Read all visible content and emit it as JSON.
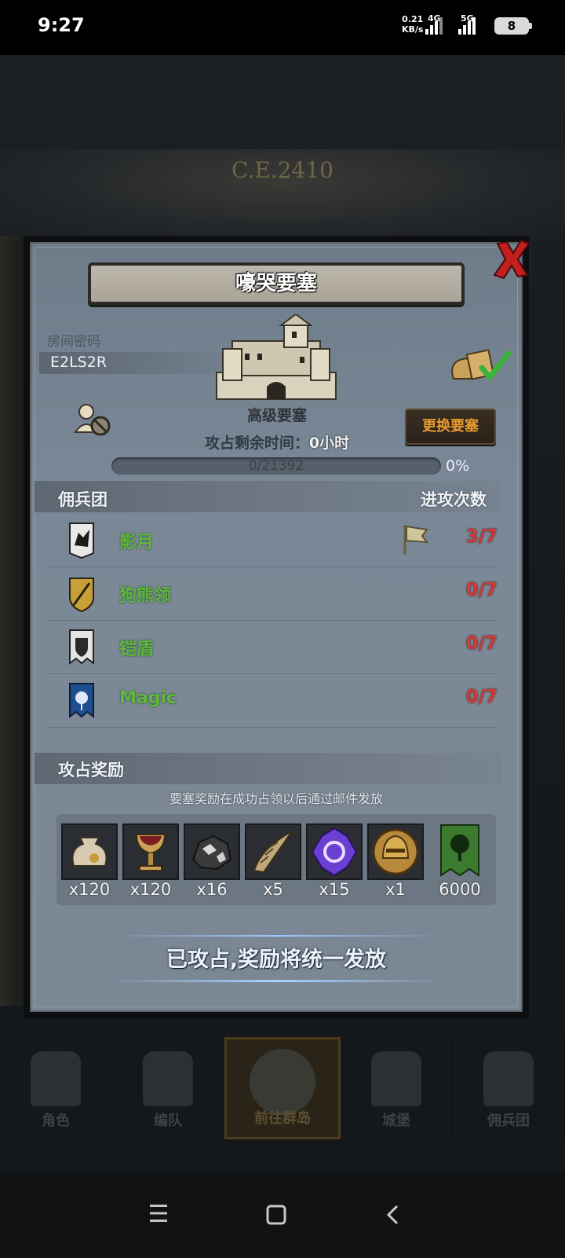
{
  "status_bar": {
    "time": "9:27",
    "net_speed": "0.21",
    "net_unit": "KB/s",
    "net1": "4G",
    "net2": "5G",
    "battery": "8"
  },
  "background": {
    "era": "C.E.2410"
  },
  "dialog": {
    "title": "嚎哭要塞",
    "room_code_label": "房间密码",
    "room_code": "E2LS2R",
    "fortress_type": "高级要塞",
    "change_button": "更换要塞",
    "remaining_label": "攻占剩余时间：",
    "remaining_value": "0小时",
    "progress_text": "0/21392",
    "progress_fraction": 0,
    "progress_percent": "0%",
    "legions_header": "佣兵团",
    "attacks_header": "进攻次数",
    "legions": [
      {
        "name": "影月",
        "count": "3/7",
        "emblem": "wolf-banner-icon",
        "flag": true
      },
      {
        "name": "狗熊领",
        "count": "0/7",
        "emblem": "sword-shield-icon",
        "flag": false
      },
      {
        "name": "铠盾",
        "count": "0/7",
        "emblem": "shield-banner-icon",
        "flag": false
      },
      {
        "name": "Magic",
        "count": "0/7",
        "emblem": "rose-banner-icon",
        "flag": false
      }
    ],
    "rewards_header": "攻占奖励",
    "rewards_note": "要塞奖励在成功占领以后通过邮件发放",
    "rewards": [
      {
        "icon": "coin-pouch-icon",
        "qty": "x120"
      },
      {
        "icon": "goblet-icon",
        "qty": "x120"
      },
      {
        "icon": "ore-rock-icon",
        "qty": "x16"
      },
      {
        "icon": "horn-icon",
        "qty": "x5"
      },
      {
        "icon": "purple-crystal-icon",
        "qty": "x15"
      },
      {
        "icon": "golden-helmet-icon",
        "qty": "x1"
      },
      {
        "icon": "tree-banner-icon",
        "qty": "6000"
      }
    ],
    "claim_button": "已攻占,奖励将统一发放"
  },
  "bottom_nav": {
    "items": [
      {
        "label": "角色",
        "icon": "knight-icon"
      },
      {
        "label": "编队",
        "icon": "formation-icon"
      },
      {
        "label": "前往群岛",
        "icon": "globe-icon",
        "active": true
      },
      {
        "label": "城堡",
        "icon": "castle-icon"
      },
      {
        "label": "佣兵团",
        "icon": "mercenary-icon"
      }
    ]
  },
  "colors": {
    "legion_name": "#5fb83a",
    "attack_count": "#cf3a3a",
    "change_button_text": "#e89a2e"
  }
}
